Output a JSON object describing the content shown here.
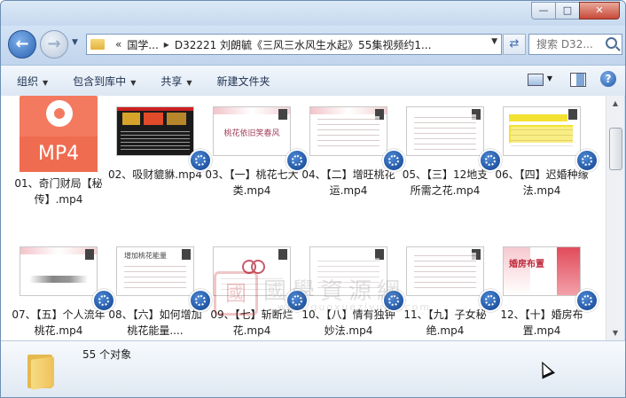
{
  "window": {
    "controls": [
      "—",
      "□",
      "✕"
    ]
  },
  "nav": {
    "address_prefix": "«",
    "breadcrumbs": [
      "国学...",
      "D32221 刘朗毓《三风三水风生水起》55集视频约1..."
    ],
    "search_placeholder": "搜索 D32..."
  },
  "toolbar": {
    "organize": "组织",
    "include_library": "包含到库中",
    "share": "共享",
    "new_folder": "新建文件夹"
  },
  "items": [
    {
      "label": "01、奇门财局【秘传】.mp4",
      "thumb": "mp4",
      "thumb_text": "MP4"
    },
    {
      "label": "02、吸财貔貅.mp4",
      "thumb": "photo",
      "thumb_text": ""
    },
    {
      "label": "03、【一】桃花七大类.mp4",
      "thumb": "slide",
      "thumb_text": "桃花依旧笑春风"
    },
    {
      "label": "04、【二】增旺桃花运.mp4",
      "thumb": "slide",
      "thumb_text": ""
    },
    {
      "label": "05、【三】12地支所需之花.mp4",
      "thumb": "slide",
      "thumb_text": ""
    },
    {
      "label": "06、【四】迟婚种缘法.mp4",
      "thumb": "yellow",
      "thumb_text": ""
    },
    {
      "label": "07、【五】个人流年桃花.mp4",
      "thumb": "slide",
      "thumb_text": ""
    },
    {
      "label": "08、【六】如何增加桃花能量....",
      "thumb": "slide",
      "thumb_text": "增加桃花能量"
    },
    {
      "label": "09、【七】斩断烂花.mp4",
      "thumb": "slide",
      "thumb_text": ""
    },
    {
      "label": "10、【八】情有独钟妙法.mp4",
      "thumb": "slide",
      "thumb_text": ""
    },
    {
      "label": "11、【九】子女秘绝.mp4",
      "thumb": "slide",
      "thumb_text": ""
    },
    {
      "label": "12、【十】婚房布置.mp4",
      "thumb": "slide",
      "thumb_text": "婚房布置"
    }
  ],
  "watermark": {
    "seal": "國",
    "text": "國學資源網",
    "url": "www.guoxueziyuan.com"
  },
  "status": {
    "count_text": "55 个对象"
  }
}
